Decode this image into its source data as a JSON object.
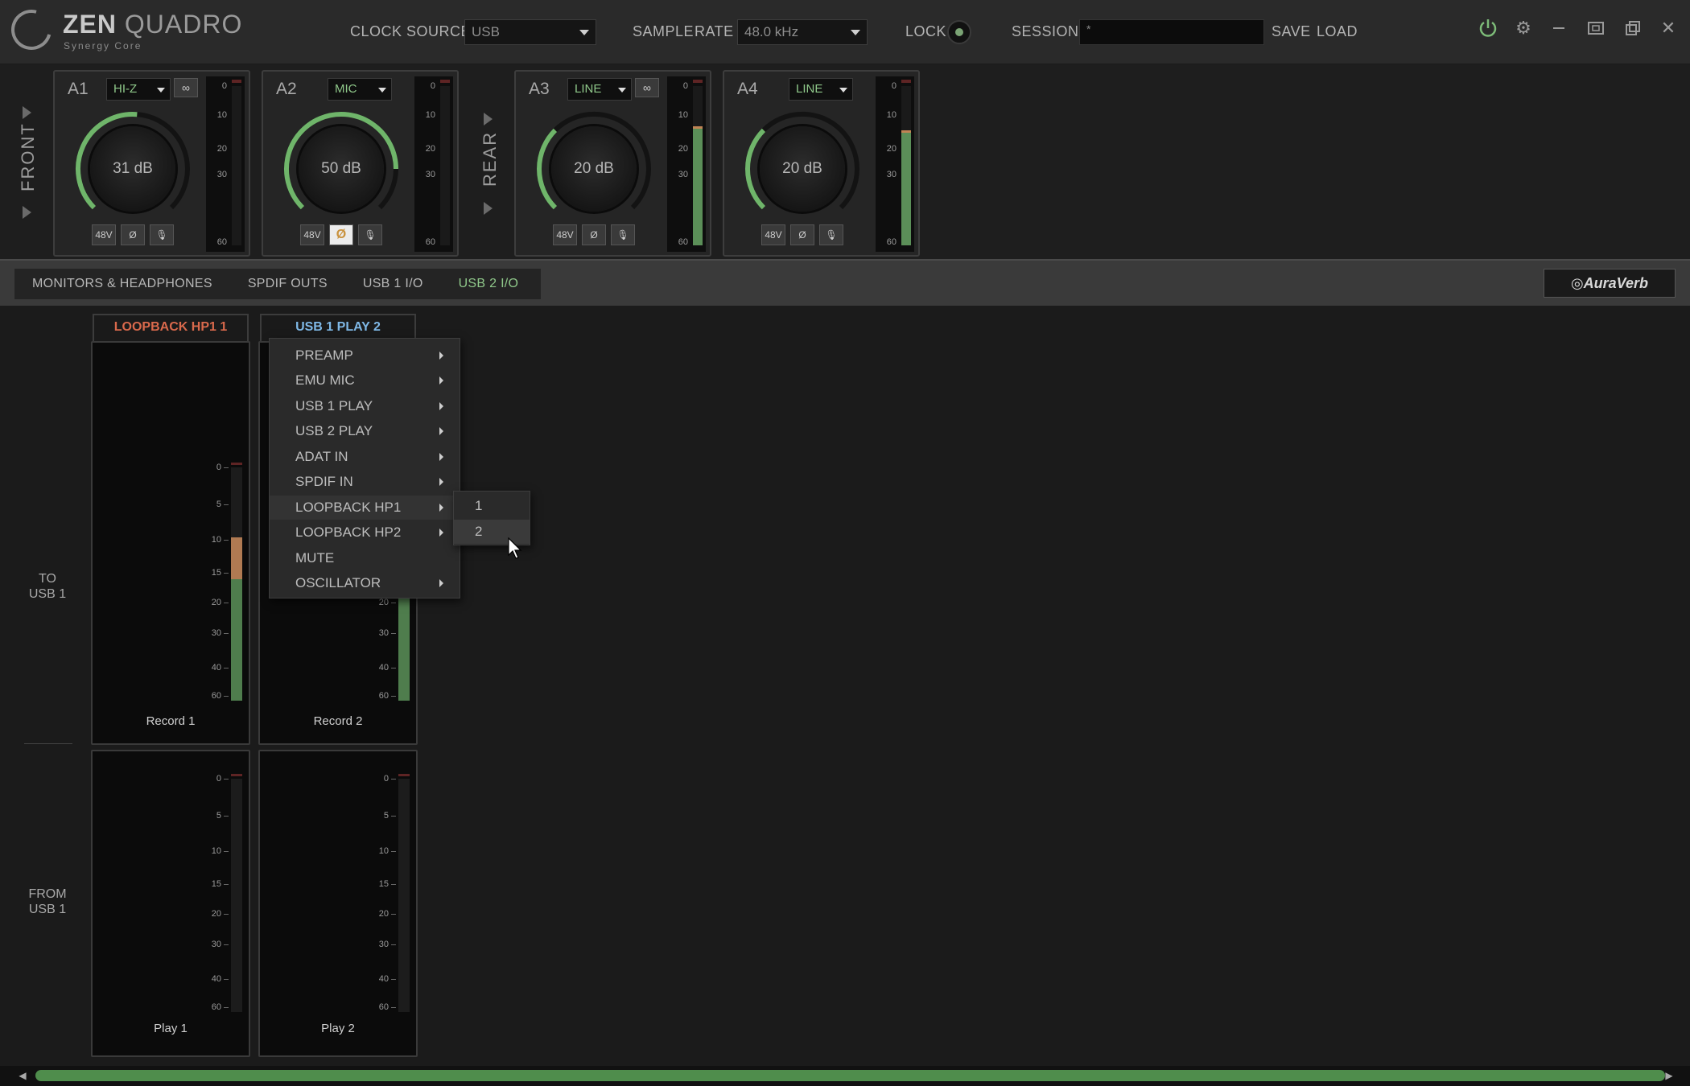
{
  "app": {
    "name_bold": "ZEN",
    "name_light": "QUADRO",
    "subtitle": "Synergy Core"
  },
  "topbar": {
    "clock_source_label": "CLOCK SOURCE",
    "clock_source_value": "USB",
    "sample_rate_label": "SAMPLE",
    "sample_rate_label2": "RATE",
    "sample_rate_value": "48.0 kHz",
    "lock_label": "LOCK",
    "session_label": "SESSION",
    "session_value": "*",
    "save_label": "SAVE",
    "load_label": "LOAD"
  },
  "inputs": {
    "front_label": "FRONT",
    "rear_label": "REAR",
    "channels": [
      {
        "name": "A1",
        "type": "HI-Z",
        "gain": "31 dB",
        "btn_48v": "48V",
        "btn_phase": "Ø",
        "btn_mic": "🎙",
        "level": 0.0
      },
      {
        "name": "A2",
        "type": "MIC",
        "gain": "50 dB",
        "btn_48v": "48V",
        "btn_phase": "Ø",
        "btn_mic": "🎙",
        "level": 0.0
      },
      {
        "name": "A3",
        "type": "LINE",
        "gain": "20 dB",
        "btn_48v": "48V",
        "btn_phase": "Ø",
        "btn_mic": "🎙",
        "level": 0.75
      },
      {
        "name": "A4",
        "type": "LINE",
        "gain": "20 dB",
        "btn_48v": "48V",
        "btn_phase": "Ø",
        "btn_mic": "🎙",
        "level": 0.72
      }
    ],
    "meter_scale": [
      "0",
      "10",
      "20",
      "30",
      "60"
    ]
  },
  "tabs": [
    {
      "label": "MONITORS & HEADPHONES"
    },
    {
      "label": "SPDIF OUTS"
    },
    {
      "label": "USB 1 I/O"
    },
    {
      "label": "USB 2 I/O"
    }
  ],
  "auraverb_label": "AuraVerb",
  "rows": {
    "to_usb_1": "TO\nUSB 1",
    "to_line1": "TO",
    "to_line2": "USB 1",
    "from_line1": "FROM",
    "from_line2": "USB 1"
  },
  "strips": {
    "record": [
      {
        "source": "LOOPBACK HP1 1",
        "source_color": "#d9694c",
        "name": "Record 1",
        "level": 0.7,
        "warm": 0.18
      },
      {
        "source": "USB 1 PLAY 2",
        "source_color": "#7fb8e6",
        "name": "Record 2",
        "level": 0.45,
        "warm": 0
      }
    ],
    "play": [
      {
        "name": "Play 1",
        "level": 0
      },
      {
        "name": "Play 2",
        "level": 0
      }
    ],
    "meter_scale": [
      "0",
      "5",
      "10",
      "15",
      "20",
      "30",
      "40",
      "60"
    ]
  },
  "context_menu": {
    "items": [
      {
        "label": "PREAMP",
        "has_sub": true
      },
      {
        "label": "EMU MIC",
        "has_sub": true
      },
      {
        "label": "USB 1 PLAY",
        "has_sub": true
      },
      {
        "label": "USB 2 PLAY",
        "has_sub": true
      },
      {
        "label": "ADAT IN",
        "has_sub": true
      },
      {
        "label": "SPDIF IN",
        "has_sub": true
      },
      {
        "label": "LOOPBACK HP1",
        "has_sub": true
      },
      {
        "label": "LOOPBACK HP2",
        "has_sub": true
      },
      {
        "label": "MUTE",
        "has_sub": false
      },
      {
        "label": "OSCILLATOR",
        "has_sub": true
      }
    ],
    "submenu": [
      "1",
      "2"
    ]
  },
  "colors": {
    "accent_green": "#8fc88a",
    "meter_green": "#5b8f58",
    "record1_source": "#d9694c",
    "record2_source": "#7fb8e6"
  }
}
